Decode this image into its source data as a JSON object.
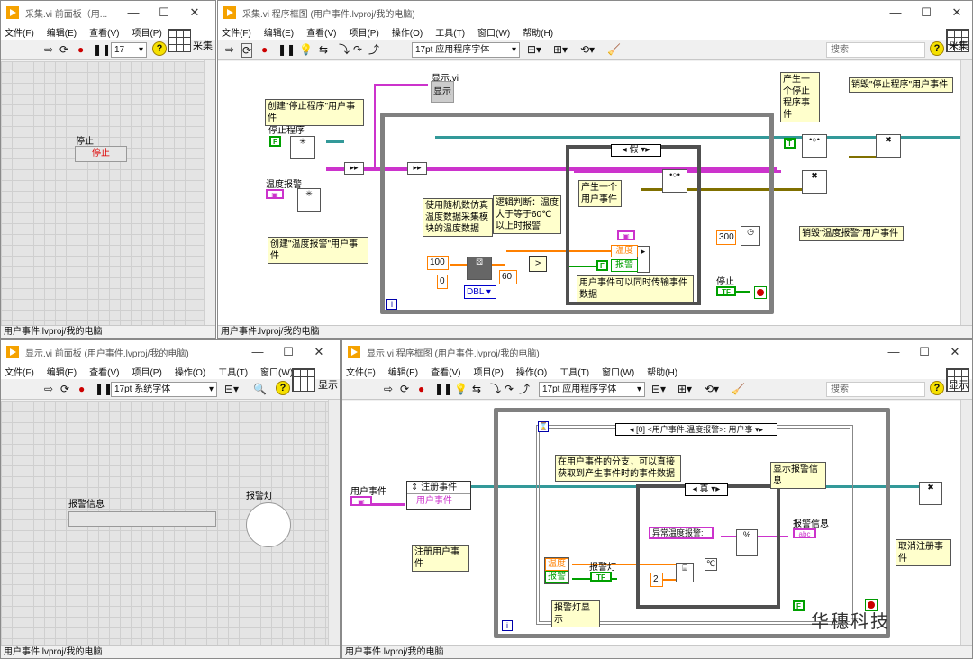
{
  "w1": {
    "title": "采集.vi 前面板（用...",
    "menus": [
      "文件(F)",
      "编辑(E)",
      "查看(V)",
      "项目(P)"
    ],
    "font_size": "17",
    "conn": "采集",
    "ctrl_label": "停止",
    "btn": "停止",
    "status": "用户事件.lvproj/我的电脑"
  },
  "w2": {
    "title": "采集.vi 程序框图 (用户事件.lvproj/我的电脑)",
    "menus": [
      "文件(F)",
      "编辑(E)",
      "查看(V)",
      "项目(P)",
      "操作(O)",
      "工具(T)",
      "窗口(W)",
      "帮助(H)"
    ],
    "font": "17pt 应用程序字体",
    "search": "搜索",
    "conn": "采集",
    "status": "用户事件.lvproj/我的电脑",
    "subvi": "显示.vi",
    "subvi_icon": "显示",
    "lbl_stop": "停止程序",
    "lbl_temp": "温度报警",
    "note_create_stop": "创建\"停止程序\"用户事件",
    "note_create_temp": "创建\"温度报警\"用户事件",
    "note_random": "使用随机数仿真温度数据采集模块的温度数据",
    "note_logic": "逻辑判断：温度大于等于60℃以上时报警",
    "note_gen1": "产生一个用户事件",
    "note_gen2": "产生一个停止程序事件",
    "note_destroy_stop": "销毁\"停止程序\"用户事件",
    "note_destroy_temp": "销毁\"温度报警\"用户事件",
    "note_multi": "用户事件可以同时传输事件数据",
    "case_false": "假",
    "c100": "100",
    "c0": "0",
    "c60": "60",
    "c300": "300",
    "dbl": "DBL",
    "cl_temp": "温度",
    "cl_alarm": "报警",
    "stop": "停止",
    "tf": "TF"
  },
  "w3": {
    "title": "显示.vi 前面板 (用户事件.lvproj/我的电脑)",
    "menus": [
      "文件(F)",
      "编辑(E)",
      "查看(V)",
      "项目(P)",
      "操作(O)",
      "工具(T)",
      "窗口(W)"
    ],
    "font": "17pt 系统字体",
    "conn": "显示",
    "lbl_info": "报警信息",
    "lbl_led": "报警灯",
    "status": "用户事件.lvproj/我的电脑"
  },
  "w4": {
    "title": "显示.vi 程序框图 (用户事件.lvproj/我的电脑)",
    "menus": [
      "文件(F)",
      "编辑(E)",
      "查看(V)",
      "项目(P)",
      "操作(O)",
      "工具(T)",
      "窗口(W)",
      "帮助(H)"
    ],
    "font": "17pt 应用程序字体",
    "search": "搜索",
    "conn": "显示",
    "status": "用户事件.lvproj/我的电脑",
    "lbl_user": "用户事件",
    "reg_title": "注册事件",
    "reg_item": "用户事件",
    "note_reg": "注册用户事件",
    "ev_sel": "[0] <用户事件.温度报警>: 用户事",
    "note_branch": "在用户事件的分支，可以直接获取到产生事件时的事件数据",
    "case_true": "真",
    "alarm_led": "报警灯",
    "cl_temp": "温度",
    "cl_alarm": "报警",
    "abn": "异常温度报警:",
    "degc": "℃",
    "c2": "2",
    "note_led": "报警灯显示",
    "note_show": "显示报警信息",
    "info": "报警信息",
    "note_unreg": "取消注册事件",
    "tf": "TF",
    "watermark": "华穗科技"
  }
}
